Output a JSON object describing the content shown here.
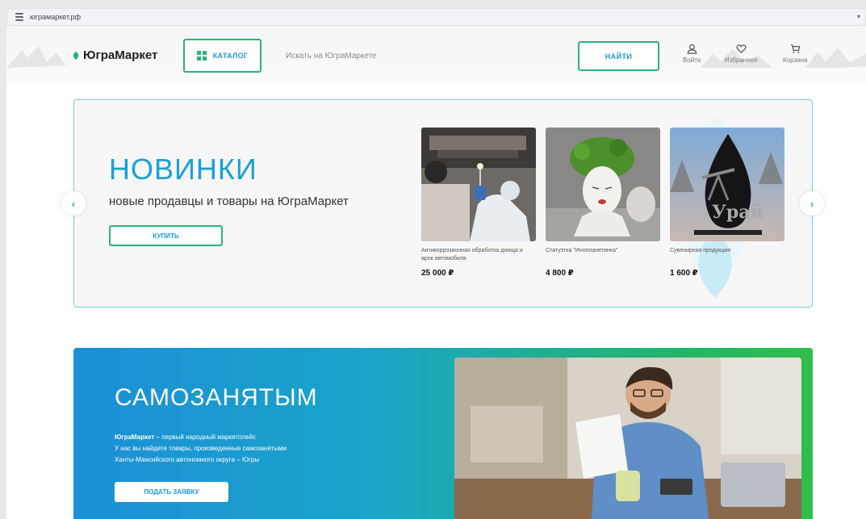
{
  "browser": {
    "url": "югрaмаркет.рф"
  },
  "header": {
    "logo": "ЮграМаркет",
    "catalog_label": "КАТАЛОГ",
    "search_placeholder": "Искать на ЮграМаркете",
    "find_label": "НАЙТИ",
    "login_label": "Войти",
    "favorites_label": "Избранное",
    "cart_label": "Корзина"
  },
  "banner": {
    "title": "НОВИНКИ",
    "subtitle": "новые продавцы и товары на ЮграМаркет",
    "buy_label": "КУПИТЬ",
    "products": [
      {
        "name": "Антикоррозионная обработка днища и арок автомобиля",
        "price": "25 000 ₽"
      },
      {
        "name": "Статуэтка \"Инопланетянка\"",
        "price": "4 800 ₽"
      },
      {
        "name": "Сувенирная продукция",
        "price": "1 600 ₽",
        "image_text": "Урай"
      }
    ]
  },
  "self_employed": {
    "title": "САМОЗАНЯТЫМ",
    "brand": "ЮграМаркет",
    "line1": " – первый народный маркетплейс",
    "line2": "У нас вы найдете товары, произведенные самозанятыми",
    "line3": "Ханты-Мансийского автономного округа – Югры",
    "apply_label": "ПОДАТЬ ЗАЯВКУ"
  },
  "colors": {
    "accent_green": "#2bb37a",
    "accent_blue": "#1a9bd7"
  },
  "icons": [
    "site-settings-icon",
    "catalog-grid-icon",
    "user-icon",
    "heart-icon",
    "cart-icon",
    "chevron-left-icon",
    "chevron-right-icon"
  ]
}
